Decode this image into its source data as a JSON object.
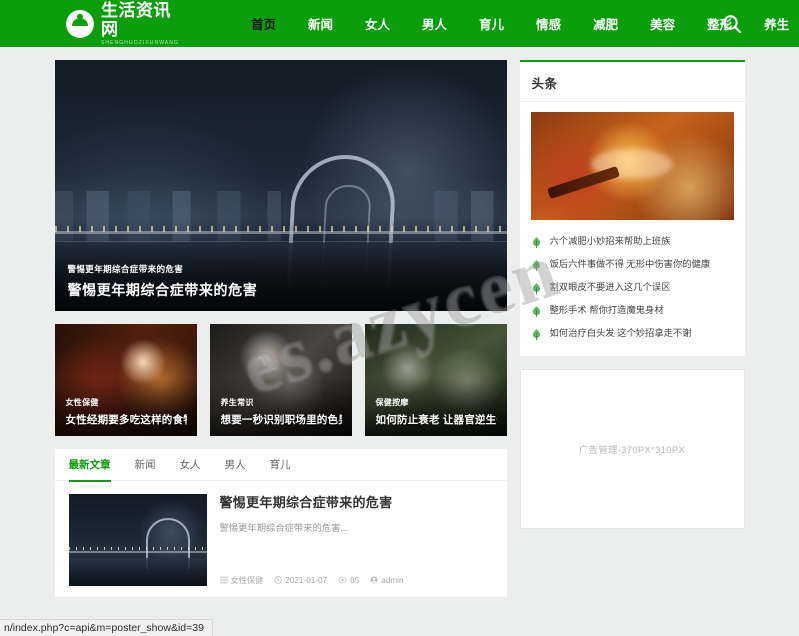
{
  "site": {
    "logo_cn": "生活资讯网",
    "logo_en": "SHENGHUOZIXUNWANG",
    "brand_color": "#0a9e0a"
  },
  "nav": {
    "items": [
      {
        "label": "首页",
        "active": true
      },
      {
        "label": "新闻",
        "active": false
      },
      {
        "label": "女人",
        "active": false
      },
      {
        "label": "男人",
        "active": false
      },
      {
        "label": "育儿",
        "active": false
      },
      {
        "label": "情感",
        "active": false
      },
      {
        "label": "减肥",
        "active": false
      },
      {
        "label": "美容",
        "active": false
      },
      {
        "label": "整形",
        "active": false
      },
      {
        "label": "养生",
        "active": false
      }
    ],
    "search_icon": "search-icon"
  },
  "hero": {
    "tag": "警惕更年期综合症带来的危害",
    "title": "警惕更年期综合症带来的危害"
  },
  "cards": [
    {
      "tag": "女性保健",
      "title": "女性经期要多吃这样的食物"
    },
    {
      "tag": "养生常识",
      "title": "想要一秒识别职场里的色男 六大绝招看过"
    },
    {
      "tag": "保健按摩",
      "title": "如何防止衰老 让器官逆生长"
    }
  ],
  "sidebar": {
    "title": "头条",
    "items": [
      {
        "text": "六个减肥小妙招来帮助上班族"
      },
      {
        "text": "饭后六件事做不得 无形中伤害你的健康"
      },
      {
        "text": "割双眼皮不要进入这几个误区"
      },
      {
        "text": "整形手术 帮你打造魔鬼身材"
      },
      {
        "text": "如何治疗白头发 这个妙招拿走不谢"
      }
    ]
  },
  "list": {
    "tabs": [
      {
        "label": "最新文章",
        "active": true
      },
      {
        "label": "新闻",
        "active": false
      },
      {
        "label": "女人",
        "active": false
      },
      {
        "label": "男人",
        "active": false
      },
      {
        "label": "育儿",
        "active": false
      }
    ],
    "article": {
      "title": "警惕更年期综合症带来的危害",
      "desc": "警惕更年期综合症带来的危害...",
      "category": "女性保健",
      "date": "2021-01-07",
      "views": "85",
      "author": "admin"
    }
  },
  "ad": {
    "placeholder": "广告管理-370PX*310PX"
  },
  "watermark": {
    "text": "es.azycen"
  },
  "statusbar": {
    "url": "n/index.php?c=api&m=poster_show&id=39"
  }
}
